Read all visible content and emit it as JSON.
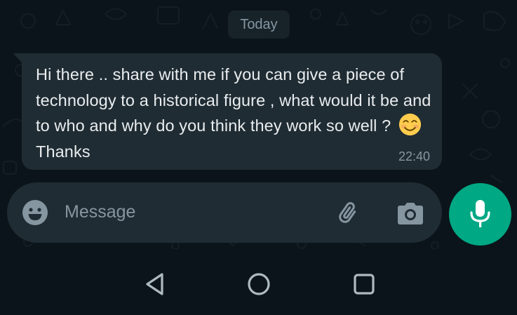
{
  "chat": {
    "date_label": "Today",
    "message": {
      "text_main": "Hi there .. share with me if you can give a piece of technology to a historical figure , what would it be and to who and why do you think they work so well ? ",
      "emoji": "smiling-face-with-smiling-eyes",
      "text_end": " Thanks",
      "time": "22:40"
    }
  },
  "composer": {
    "placeholder": "Message",
    "value": "",
    "icons": {
      "emoji": "emoji-icon",
      "attach": "paperclip-icon",
      "camera": "camera-icon",
      "send": "mic-icon"
    }
  },
  "navigation": {
    "icons": [
      "back-icon",
      "home-icon",
      "recents-icon"
    ]
  },
  "colors": {
    "background": "#0b141a",
    "bubble": "#202c33",
    "input": "#1f2c34",
    "accent": "#00a884",
    "text_primary": "#e9edef",
    "text_secondary": "#8696a0"
  }
}
